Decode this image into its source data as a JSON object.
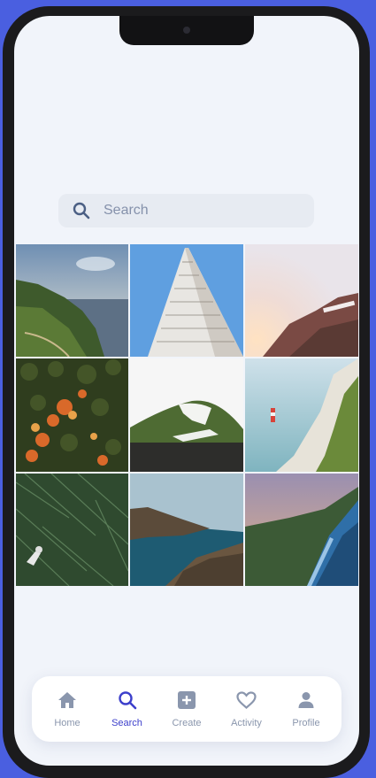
{
  "search": {
    "placeholder": "Search"
  },
  "photos": [
    {
      "subject": "coastal cliffs at sunset"
    },
    {
      "subject": "skyscraper looking up"
    },
    {
      "subject": "hollywood hills sign"
    },
    {
      "subject": "aerial autumn forest"
    },
    {
      "subject": "snowy green hill"
    },
    {
      "subject": "lighthouse and white cliffs"
    },
    {
      "subject": "person lying in tall grass"
    },
    {
      "subject": "rocky sea coast"
    },
    {
      "subject": "coastal road at dusk"
    }
  ],
  "tabbar": {
    "active": "search",
    "tabs": [
      {
        "key": "home",
        "label": "Home",
        "icon": "home-icon"
      },
      {
        "key": "search",
        "label": "Search",
        "icon": "search-icon"
      },
      {
        "key": "create",
        "label": "Create",
        "icon": "plus-square-icon"
      },
      {
        "key": "activity",
        "label": "Activity",
        "icon": "heart-icon"
      },
      {
        "key": "profile",
        "label": "Profile",
        "icon": "person-icon"
      }
    ]
  },
  "colors": {
    "accent": "#3c3fcb",
    "inactive": "#8a96ad",
    "background": "#4a5fe0"
  }
}
